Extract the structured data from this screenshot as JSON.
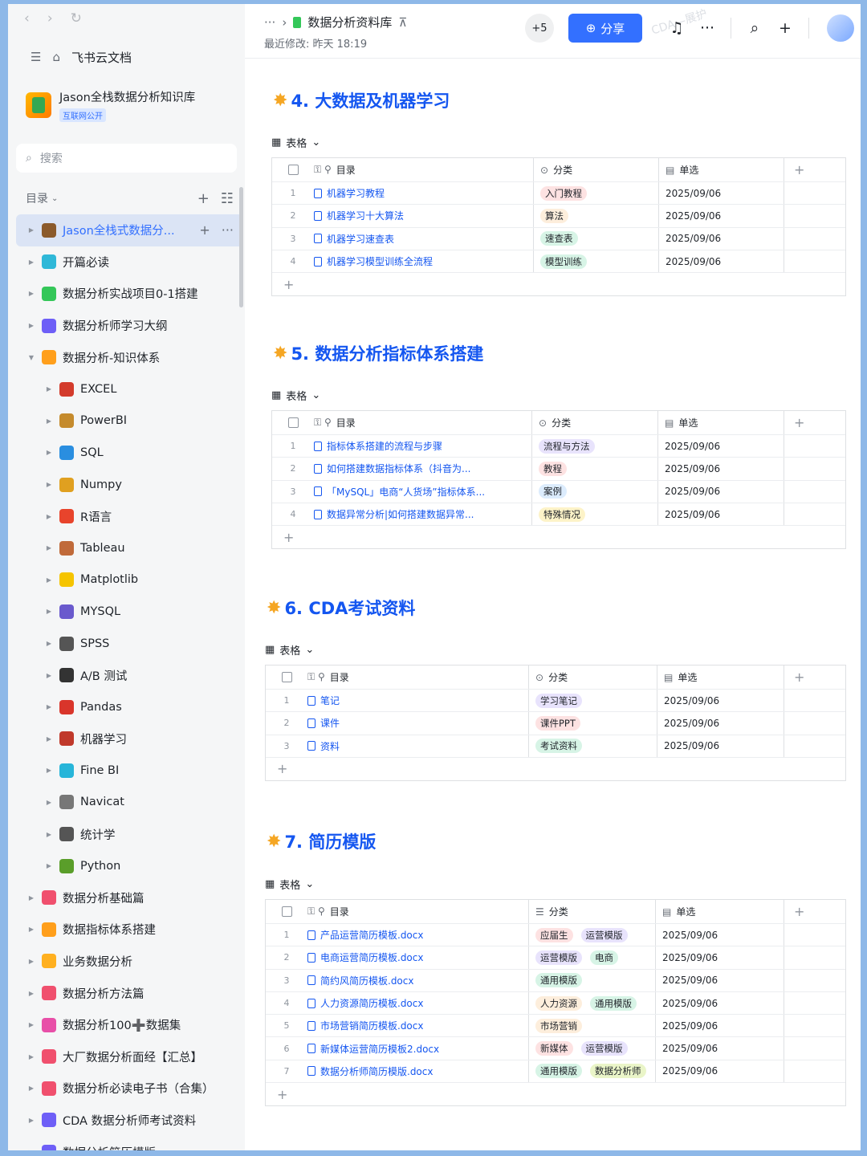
{
  "sidebar": {
    "home_label": "飞书云文档",
    "kb_title": "Jason全栈数据分析知识库",
    "kb_badge": "互联网公开",
    "search_placeholder": "搜索",
    "toc_label": "目录",
    "items": [
      {
        "label": "Jason全栈式数据分...",
        "level": 0,
        "selected": true,
        "icon": "feather-icon",
        "color": "#8b5a2b"
      },
      {
        "label": "开篇必读",
        "level": 0,
        "icon": "spark-icon",
        "color": "#2fb8d8"
      },
      {
        "label": "数据分析实战项目0-1搭建",
        "level": 0,
        "icon": "project-icon",
        "color": "#34c759"
      },
      {
        "label": "数据分析师学习大纲",
        "level": 0,
        "icon": "clock-icon",
        "color": "#6e5ff7"
      },
      {
        "label": "数据分析-知识体系",
        "level": 0,
        "expanded": true,
        "icon": "book-icon",
        "color": "#ff9f1c"
      },
      {
        "label": "EXCEL",
        "level": 1,
        "icon": "bug-icon",
        "color": "#d33b2c"
      },
      {
        "label": "PowerBI",
        "level": 1,
        "icon": "person-icon",
        "color": "#c58b2d"
      },
      {
        "label": "SQL",
        "level": 1,
        "icon": "db-icon",
        "color": "#2a8ee0"
      },
      {
        "label": "Numpy",
        "level": 1,
        "icon": "tool-icon",
        "color": "#e0a020"
      },
      {
        "label": "R语言",
        "level": 1,
        "icon": "square-icon",
        "color": "#e8442c"
      },
      {
        "label": "Tableau",
        "level": 1,
        "icon": "box-icon",
        "color": "#c06a3a"
      },
      {
        "label": "Matplotlib",
        "level": 1,
        "icon": "pie-icon",
        "color": "#f5c400"
      },
      {
        "label": "MYSQL",
        "level": 1,
        "icon": "circle-icon",
        "color": "#6a5acd"
      },
      {
        "label": "SPSS",
        "level": 1,
        "icon": "pen-icon",
        "color": "#555555"
      },
      {
        "label": "A/B 测试",
        "level": 1,
        "icon": "rune-icon",
        "color": "#333333"
      },
      {
        "label": "Pandas",
        "level": 1,
        "icon": "mushroom-icon",
        "color": "#d9352b"
      },
      {
        "label": "机器学习",
        "level": 1,
        "icon": "chart-icon",
        "color": "#c0392b"
      },
      {
        "label": "Fine BI",
        "level": 1,
        "icon": "globe-icon",
        "color": "#27b5d9"
      },
      {
        "label": "Navicat",
        "level": 1,
        "icon": "gear-icon",
        "color": "#777777"
      },
      {
        "label": "统计学",
        "level": 1,
        "icon": "note-icon",
        "color": "#555555"
      },
      {
        "label": "Python",
        "level": 1,
        "icon": "snake-icon",
        "color": "#5a9e2a"
      },
      {
        "label": "数据分析基础篇",
        "level": 0,
        "icon": "folder-icon",
        "color": "#f0506e"
      },
      {
        "label": "数据指标体系搭建",
        "level": 0,
        "icon": "folder-icon",
        "color": "#ff9f1c"
      },
      {
        "label": "业务数据分析",
        "level": 0,
        "icon": "folder-icon",
        "color": "#ffb020"
      },
      {
        "label": "数据分析方法篇",
        "level": 0,
        "icon": "folder-icon",
        "color": "#f0506e"
      },
      {
        "label": "数据分析100➕数据集",
        "level": 0,
        "icon": "folder-icon",
        "color": "#e84fa8"
      },
      {
        "label": "大厂数据分析面经【汇总】",
        "level": 0,
        "icon": "folder-icon",
        "color": "#f0506e"
      },
      {
        "label": "数据分析必读电子书（合集）",
        "level": 0,
        "icon": "folder-icon",
        "color": "#f0506e"
      },
      {
        "label": "CDA 数据分析师考试资料",
        "level": 0,
        "icon": "folder-icon",
        "color": "#6e5ff7"
      },
      {
        "label": "数据分析简历模版",
        "level": 0,
        "icon": "folder-icon",
        "color": "#6e5ff7"
      }
    ]
  },
  "topbar": {
    "title": "数据分析资料库",
    "modified": "最近修改: 昨天 18:19",
    "collaborators": "+5",
    "share_label": "分享",
    "watermark": "CDA—展护"
  },
  "sections": [
    {
      "title": "4. 大数据及机器学习",
      "table_label": "表格",
      "columns": [
        "目录",
        "分类",
        "单选"
      ],
      "rows": [
        {
          "n": "1",
          "name": "机器学习教程",
          "tags": [
            {
              "t": "入门教程",
              "bg": "#fde2e2"
            }
          ],
          "date": "2025/09/06"
        },
        {
          "n": "2",
          "name": "机器学习十大算法",
          "tags": [
            {
              "t": "算法",
              "bg": "#fdeedc"
            }
          ],
          "date": "2025/09/06"
        },
        {
          "n": "3",
          "name": "机器学习速查表",
          "tags": [
            {
              "t": "速查表",
              "bg": "#d7f4e6"
            }
          ],
          "date": "2025/09/06"
        },
        {
          "n": "4",
          "name": "机器学习模型训练全流程",
          "tags": [
            {
              "t": "模型训练",
              "bg": "#d7f4e6"
            }
          ],
          "date": "2025/09/06"
        }
      ]
    },
    {
      "title": "5. 数据分析指标体系搭建",
      "table_label": "表格",
      "columns": [
        "目录",
        "分类",
        "单选"
      ],
      "rows": [
        {
          "n": "1",
          "name": "指标体系搭建的流程与步骤",
          "tags": [
            {
              "t": "流程与方法",
              "bg": "#e8e3fc"
            }
          ],
          "date": "2025/09/06"
        },
        {
          "n": "2",
          "name": "如何搭建数据指标体系（抖音为...",
          "tags": [
            {
              "t": "教程",
              "bg": "#fde2e2"
            }
          ],
          "date": "2025/09/06"
        },
        {
          "n": "3",
          "name": "「MySQL」电商“人货场”指标体系...",
          "tags": [
            {
              "t": "案例",
              "bg": "#dcecfd"
            }
          ],
          "date": "2025/09/06"
        },
        {
          "n": "4",
          "name": "数据异常分析|如何搭建数据异常...",
          "tags": [
            {
              "t": "特殊情况",
              "bg": "#fdf3c8"
            }
          ],
          "date": "2025/09/06"
        }
      ]
    },
    {
      "title": "6. CDA考试资料",
      "table_label": "表格",
      "columns": [
        "目录",
        "分类",
        "单选"
      ],
      "rows": [
        {
          "n": "1",
          "name": "笔记",
          "tags": [
            {
              "t": "学习笔记",
              "bg": "#e8e3fc"
            }
          ],
          "date": "2025/09/06"
        },
        {
          "n": "2",
          "name": "课件",
          "tags": [
            {
              "t": "课件PPT",
              "bg": "#fde2e2"
            }
          ],
          "date": "2025/09/06"
        },
        {
          "n": "3",
          "name": "资料",
          "tags": [
            {
              "t": "考试资料",
              "bg": "#d7f4e6"
            }
          ],
          "date": "2025/09/06"
        }
      ]
    },
    {
      "title": "7. 简历模版",
      "table_label": "表格",
      "columns": [
        "目录",
        "分类",
        "单选"
      ],
      "rows": [
        {
          "n": "1",
          "name": "产品运营简历模板.docx",
          "tags": [
            {
              "t": "应届生",
              "bg": "#fde2e2"
            },
            {
              "t": "运营模版",
              "bg": "#e8e3fc"
            }
          ],
          "date": "2025/09/06"
        },
        {
          "n": "2",
          "name": "电商运营简历模板.docx",
          "tags": [
            {
              "t": "运营模版",
              "bg": "#e8e3fc"
            },
            {
              "t": "电商",
              "bg": "#d7f4e6"
            }
          ],
          "date": "2025/09/06"
        },
        {
          "n": "3",
          "name": "简约风简历模板.docx",
          "tags": [
            {
              "t": "通用模版",
              "bg": "#d7f4e6"
            }
          ],
          "date": "2025/09/06"
        },
        {
          "n": "4",
          "name": "人力资源简历模板.docx",
          "tags": [
            {
              "t": "人力资源",
              "bg": "#fdeedc"
            },
            {
              "t": "通用模版",
              "bg": "#d7f4e6"
            }
          ],
          "date": "2025/09/06"
        },
        {
          "n": "5",
          "name": "市场营销简历模板.docx",
          "tags": [
            {
              "t": "市场营销",
              "bg": "#fdeedc"
            }
          ],
          "date": "2025/09/06"
        },
        {
          "n": "6",
          "name": "新媒体运营简历模板2.docx",
          "tags": [
            {
              "t": "新媒体",
              "bg": "#fde2e2"
            },
            {
              "t": "运营模版",
              "bg": "#e8e3fc"
            }
          ],
          "date": "2025/09/06"
        },
        {
          "n": "7",
          "name": "数据分析师简历模版.docx",
          "tags": [
            {
              "t": "通用模版",
              "bg": "#d7f4e6"
            },
            {
              "t": "数据分析师",
              "bg": "#eaf5c8"
            }
          ],
          "date": "2025/09/06"
        }
      ]
    }
  ]
}
